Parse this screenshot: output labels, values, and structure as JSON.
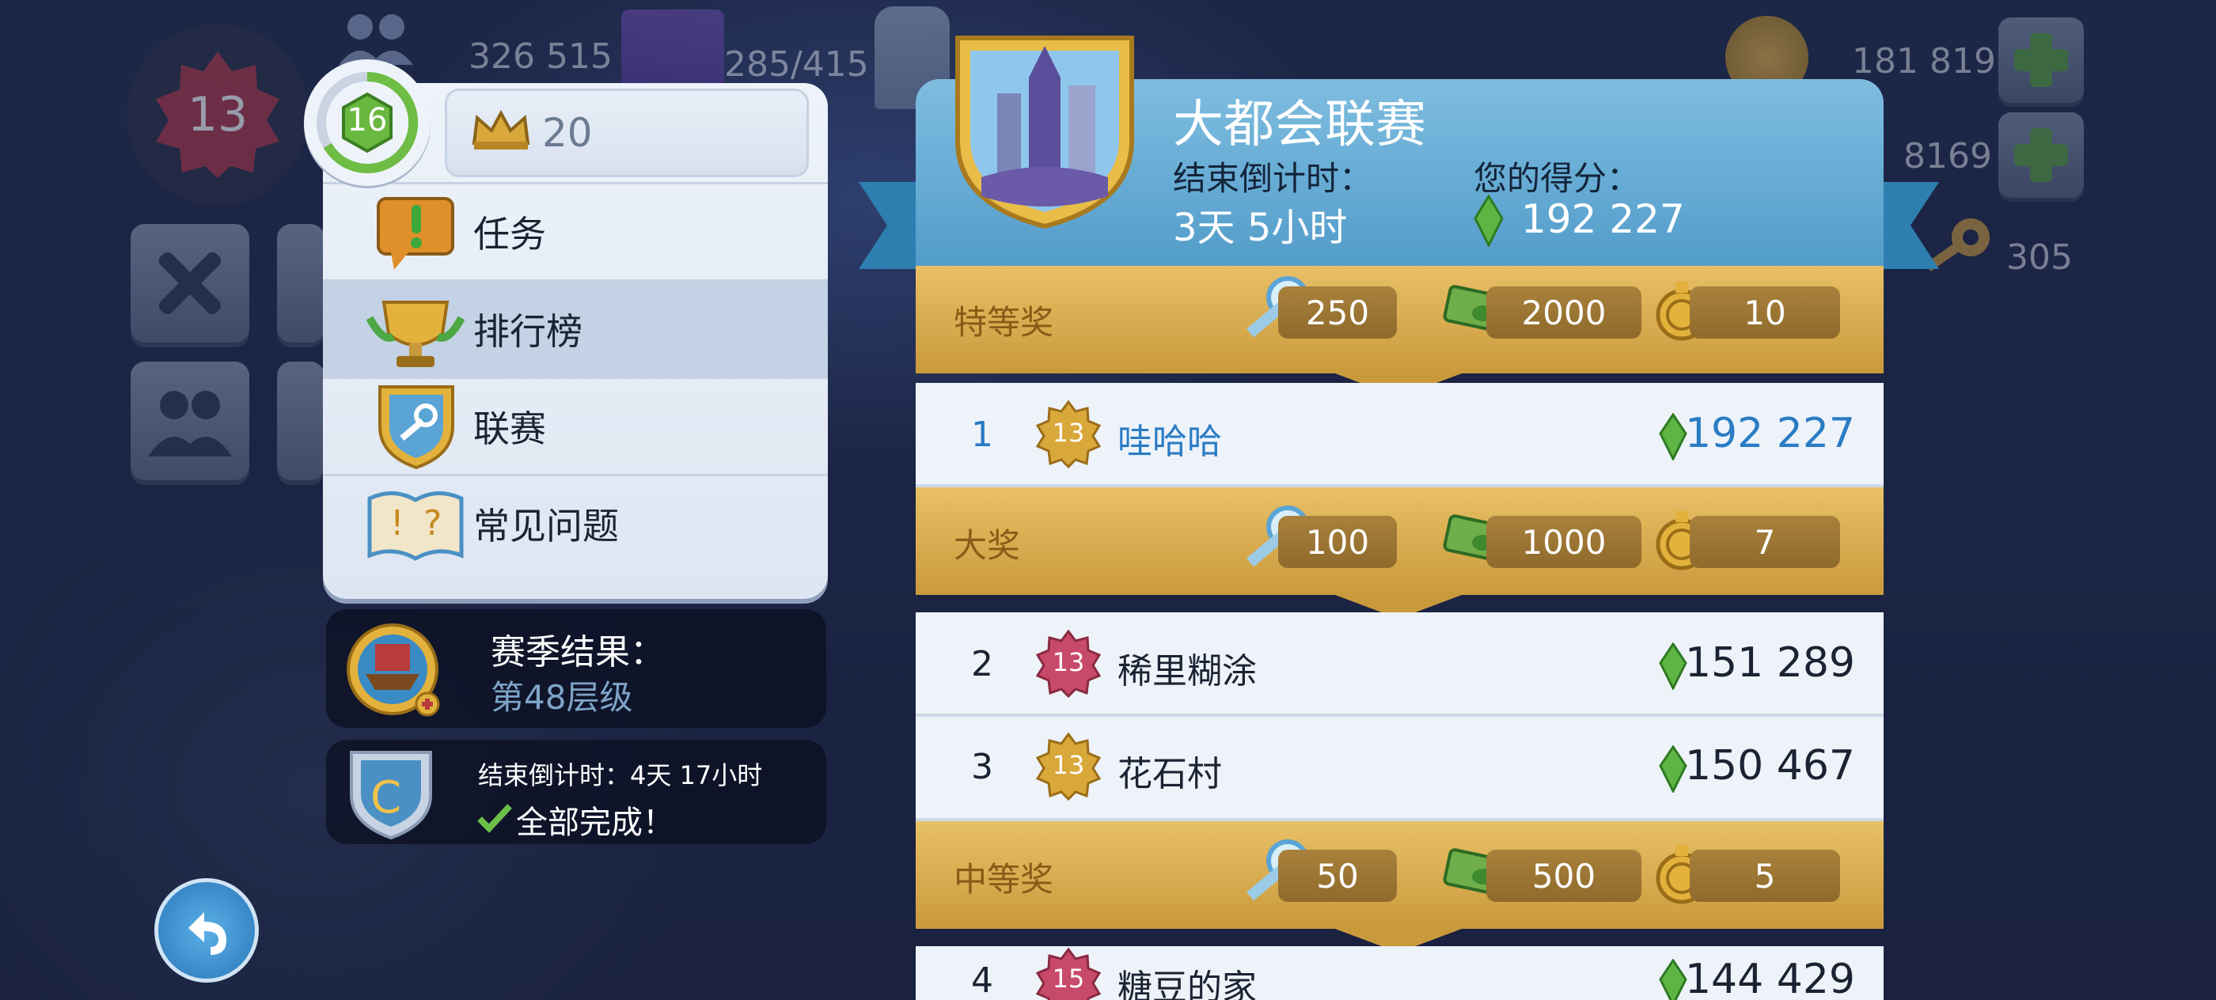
{
  "hud": {
    "level": "13",
    "population": "326 515",
    "storage": "285/415",
    "simoleons": "181 819",
    "simcash": "8169",
    "keys": "305"
  },
  "menu": {
    "player_level": "16",
    "crowns": "20",
    "items": [
      {
        "label": "任务",
        "icon": "quest-speech-icon"
      },
      {
        "label": "排行榜",
        "icon": "trophy-icon"
      },
      {
        "label": "联赛",
        "icon": "league-shield-icon"
      },
      {
        "label": "常见问题",
        "icon": "faq-book-icon"
      }
    ],
    "selected_index": 1
  },
  "season": {
    "title": "赛季结果：",
    "tier": "第48层级"
  },
  "task": {
    "countdown": "结束倒计时：4天 17小时",
    "status": "全部完成！"
  },
  "contest": {
    "title": "大都会联赛",
    "countdown_label": "结束倒计时：",
    "countdown_value": "3天 5小时",
    "score_label": "您的得分：",
    "score_value": "192 227",
    "tiers": [
      {
        "name": "特等奖",
        "keys": "250",
        "cash": "2000",
        "tokens": "10"
      },
      {
        "name": "大奖",
        "keys": "100",
        "cash": "1000",
        "tokens": "7"
      },
      {
        "name": "中等奖",
        "keys": "50",
        "cash": "500",
        "tokens": "5"
      }
    ],
    "players": [
      {
        "rank": "1",
        "level": "13",
        "name": "哇哈哈",
        "score": "192 227"
      },
      {
        "rank": "2",
        "level": "13",
        "name": "稀里糊涂",
        "score": "151 289"
      },
      {
        "rank": "3",
        "level": "13",
        "name": "花石村",
        "score": "150 467"
      },
      {
        "rank": "4",
        "level": "15",
        "name": "糖豆的家",
        "score": "144 429"
      }
    ]
  },
  "colors": {
    "accent_blue": "#4a97c6",
    "prize_gold": "#e2b95e",
    "me_text": "#2a7cc4",
    "gem_green": "#5fb544"
  }
}
